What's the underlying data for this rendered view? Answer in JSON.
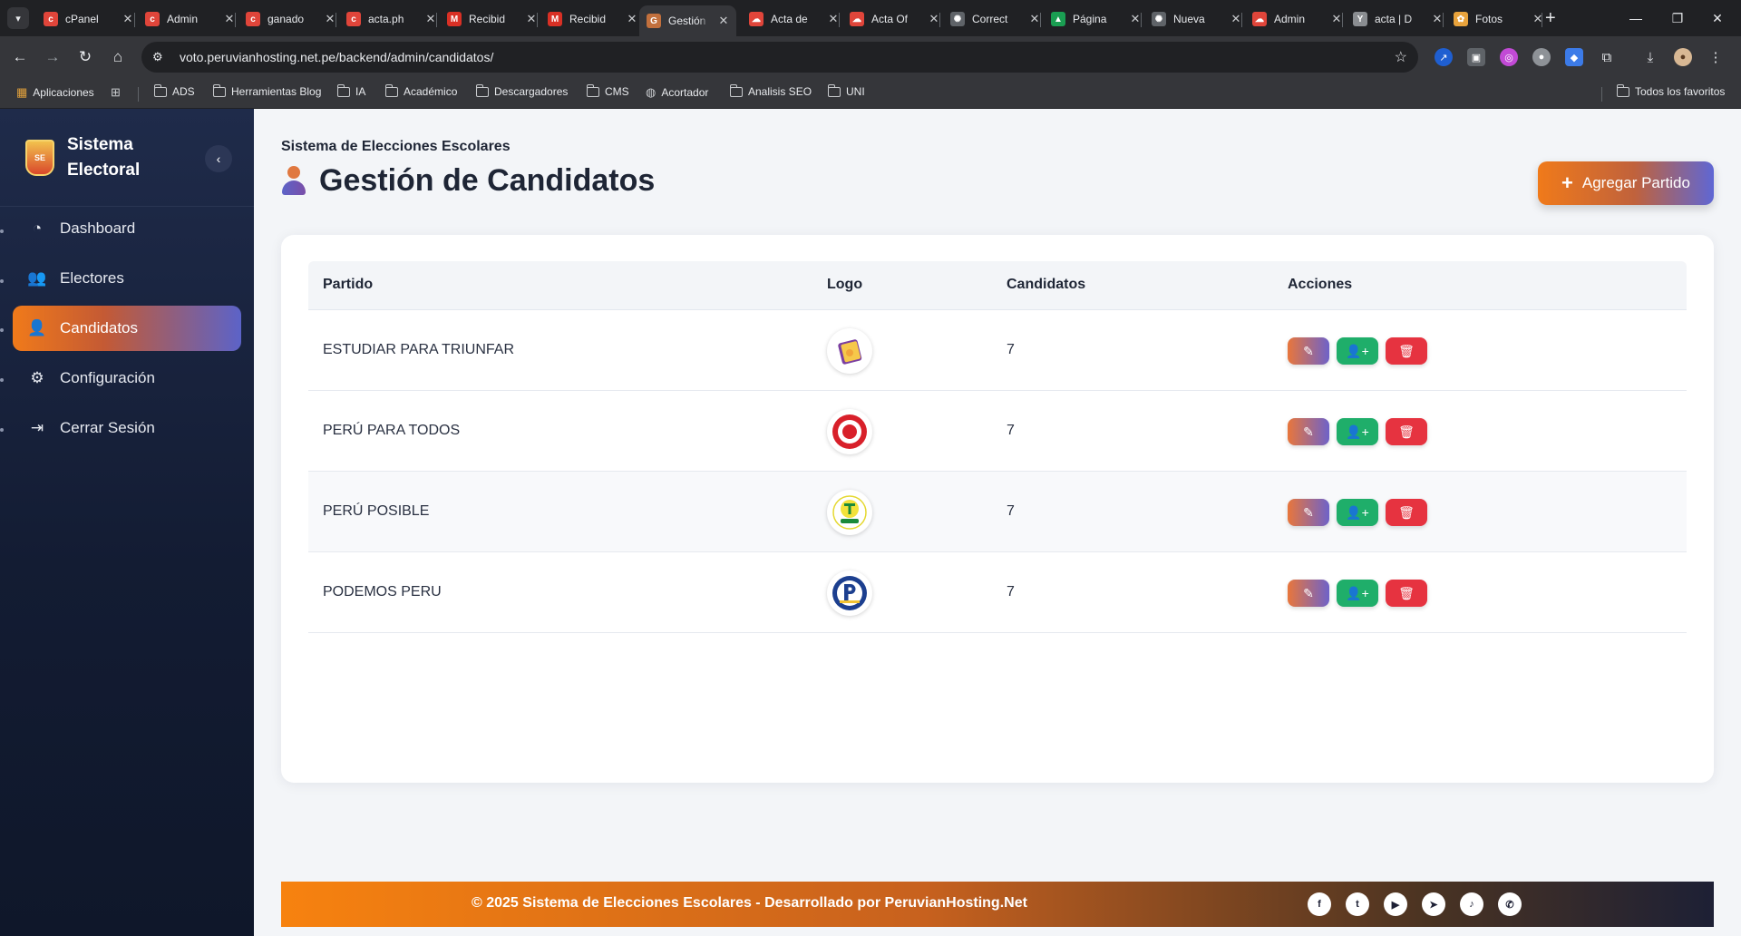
{
  "browser": {
    "tabs": [
      {
        "title": "cPanel",
        "icon": "cpanel-icon",
        "color": "#e0453a"
      },
      {
        "title": "Admin",
        "icon": "cpanel-icon",
        "color": "#e0453a"
      },
      {
        "title": "ganado",
        "icon": "cpanel-icon",
        "color": "#e0453a"
      },
      {
        "title": "acta.ph",
        "icon": "cpanel-icon",
        "color": "#e0453a"
      },
      {
        "title": "Recibid",
        "icon": "gmail-icon",
        "color": "#d93025"
      },
      {
        "title": "Recibid",
        "icon": "gmail-icon",
        "color": "#d93025"
      },
      {
        "title": "Gestión",
        "icon": "site-icon",
        "color": "#c2703d",
        "active": true
      },
      {
        "title": "Acta de",
        "icon": "cloud-icon",
        "color": "#e0453a"
      },
      {
        "title": "Acta Of",
        "icon": "cloud-icon",
        "color": "#e0453a"
      },
      {
        "title": "Correct",
        "icon": "chatgpt-icon",
        "color": "#5f6368"
      },
      {
        "title": "Página",
        "icon": "drive-icon",
        "color": "#1a9e52"
      },
      {
        "title": "Nueva",
        "icon": "chatgpt-icon",
        "color": "#5f6368"
      },
      {
        "title": "Admin",
        "icon": "cloud-icon",
        "color": "#e0453a"
      },
      {
        "title": "acta | D",
        "icon": "doc-icon",
        "color": "#8a8d91"
      },
      {
        "title": "Fotos",
        "icon": "photos-icon",
        "color": "#e8a33c"
      }
    ],
    "url": "voto.peruvianhosting.net.pe/backend/admin/candidatos/",
    "bookmarks": [
      "Aplicaciones",
      "ADS",
      "Herramientas Blog",
      "IA",
      "Académico",
      "Descargadores",
      "CMS",
      "Acortador",
      "Analisis SEO",
      "UNI"
    ],
    "all_bookmarks": "Todos los favoritos"
  },
  "sidebar": {
    "brand": "Sistema Electoral",
    "brand_logo_text": "SE",
    "items": [
      {
        "label": "Dashboard",
        "icon": "dashboard-icon"
      },
      {
        "label": "Electores",
        "icon": "users-icon"
      },
      {
        "label": "Candidatos",
        "icon": "user-icon",
        "active": true
      },
      {
        "label": "Configuración",
        "icon": "gear-icon"
      },
      {
        "label": "Cerrar Sesión",
        "icon": "logout-icon"
      }
    ]
  },
  "header": {
    "subtitle": "Sistema de Elecciones Escolares",
    "title": "Gestión de Candidatos",
    "add_button": "Agregar Partido"
  },
  "table": {
    "columns": [
      "Partido",
      "Logo",
      "Candidatos",
      "Acciones"
    ],
    "rows": [
      {
        "partido": "ESTUDIAR PARA TRIUNFAR",
        "candidatos": "7",
        "logo": "book-logo"
      },
      {
        "partido": "PERÚ PARA TODOS",
        "candidatos": "7",
        "logo": "target-logo"
      },
      {
        "partido": "PERÚ POSIBLE",
        "candidatos": "7",
        "logo": "peru-posible-logo"
      },
      {
        "partido": "PODEMOS PERU",
        "candidatos": "7",
        "logo": "podemos-logo"
      }
    ]
  },
  "footer": {
    "text": "© 2025 Sistema de Elecciones Escolares - Desarrollado por PeruvianHosting.Net",
    "social": [
      "facebook-icon",
      "twitter-icon",
      "youtube-icon",
      "telegram-icon",
      "tiktok-icon",
      "whatsapp-icon"
    ]
  },
  "colors": {
    "accent_orange": "#f07a1a",
    "accent_purple": "#5c63c8",
    "sidebar_bg": "#1a2440",
    "success": "#1fae6a",
    "danger": "#e63340"
  }
}
